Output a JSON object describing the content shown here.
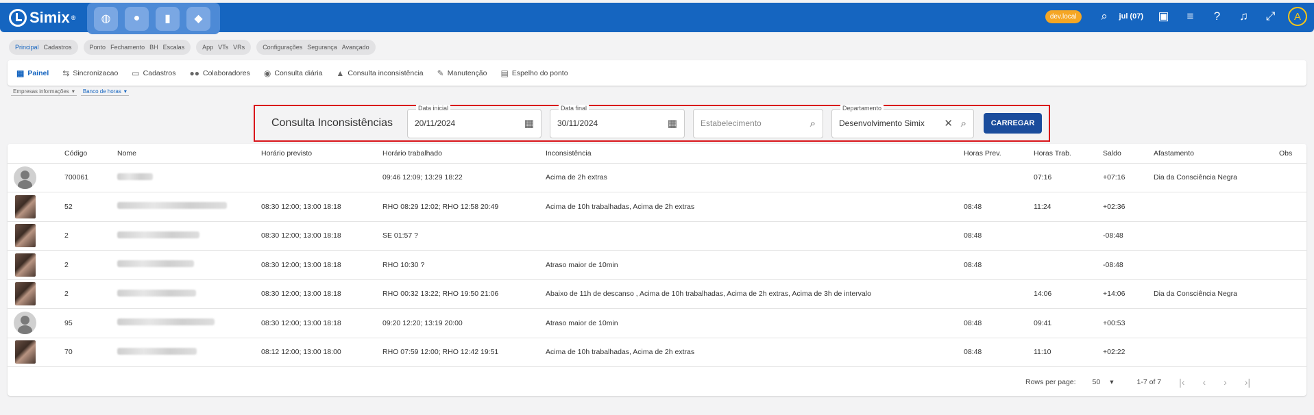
{
  "app": {
    "name": "Simix",
    "trademark": "®"
  },
  "topbar": {
    "env_badge": "dev.local",
    "month": "jul (07)",
    "avatar_letter": "A"
  },
  "groups": [
    {
      "items": [
        "Principal",
        "Cadastros"
      ]
    },
    {
      "items": [
        "Ponto",
        "Fechamento",
        "BH",
        "Escalas"
      ]
    },
    {
      "items": [
        "App",
        "VTs",
        "VRs"
      ]
    },
    {
      "items": [
        "Configurações",
        "Segurança",
        "Avançado"
      ]
    }
  ],
  "subnav": [
    {
      "label": "Painel",
      "icon": "dashboard-icon"
    },
    {
      "label": "Sincronizacao",
      "icon": "sync-icon"
    },
    {
      "label": "Cadastros",
      "icon": "folder-icon"
    },
    {
      "label": "Colaboradores",
      "icon": "people-icon"
    },
    {
      "label": "Consulta diária",
      "icon": "eye-icon"
    },
    {
      "label": "Consulta inconsistência",
      "icon": "warning-icon"
    },
    {
      "label": "Manutenção",
      "icon": "pencil-icon"
    },
    {
      "label": "Espelho do ponto",
      "icon": "printer-icon"
    }
  ],
  "chips": [
    "Empresas informações",
    "Banco de horas"
  ],
  "filter": {
    "title": "Consulta Inconsistências",
    "data_inicial_label": "Data inicial",
    "data_inicial": "20/11/2024",
    "data_final_label": "Data final",
    "data_final": "30/11/2024",
    "estabelecimento_placeholder": "Estabelecimento",
    "departamento_label": "Departamento",
    "departamento": "Desenvolvimento Simix",
    "button": "CARREGAR"
  },
  "table": {
    "headers": [
      "Código",
      "Nome",
      "Horário previsto",
      "Horário trabalhado",
      "Inconsistência",
      "Horas Prev.",
      "Horas Trab.",
      "Saldo",
      "Afastamento",
      "Obs"
    ],
    "rows": [
      {
        "avatar": "default",
        "codigo": "700061",
        "previsto": "",
        "trabalhado": "09:46 12:09; 13:29 18:22",
        "inconsistencia": "Acima de 2h extras",
        "horas_prev": "",
        "horas_trab": "07:16",
        "saldo": "+07:16",
        "afastamento": "Dia da Consciência Negra",
        "obs": ""
      },
      {
        "avatar": "photo",
        "codigo": "52",
        "previsto": "08:30 12:00; 13:00 18:18",
        "trabalhado": "RHO 08:29 12:02; RHO 12:58 20:49",
        "inconsistencia": "Acima de 10h trabalhadas, Acima de 2h extras",
        "horas_prev": "08:48",
        "horas_trab": "11:24",
        "saldo": "+02:36",
        "afastamento": "",
        "obs": ""
      },
      {
        "avatar": "photo",
        "codigo": "2",
        "previsto": "08:30 12:00; 13:00 18:18",
        "trabalhado": "SE 01:57 ?",
        "inconsistencia": "",
        "horas_prev": "08:48",
        "horas_trab": "",
        "saldo": "-08:48",
        "afastamento": "",
        "obs": ""
      },
      {
        "avatar": "photo",
        "codigo": "2",
        "previsto": "08:30 12:00; 13:00 18:18",
        "trabalhado": "RHO 10:30 ?",
        "inconsistencia": "Atraso maior de 10min",
        "horas_prev": "08:48",
        "horas_trab": "",
        "saldo": "-08:48",
        "afastamento": "",
        "obs": ""
      },
      {
        "avatar": "photo",
        "codigo": "2",
        "previsto": "08:30 12:00; 13:00 18:18",
        "trabalhado": "RHO 00:32 13:22; RHO 19:50 21:06",
        "inconsistencia": "Abaixo de 11h de descanso , Acima de 10h trabalhadas, Acima de 2h extras, Acima de 3h de intervalo",
        "horas_prev": "",
        "horas_trab": "14:06",
        "saldo": "+14:06",
        "afastamento": "Dia da Consciência Negra",
        "obs": ""
      },
      {
        "avatar": "default",
        "codigo": "95",
        "previsto": "08:30 12:00; 13:00 18:18",
        "trabalhado": "09:20 12:20; 13:19 20:00",
        "inconsistencia": "Atraso maior de 10min",
        "horas_prev": "08:48",
        "horas_trab": "09:41",
        "saldo": "+00:53",
        "afastamento": "",
        "obs": ""
      },
      {
        "avatar": "photo",
        "codigo": "70",
        "previsto": "08:12 12:00; 13:00 18:00",
        "trabalhado": "RHO 07:59 12:00; RHO 12:42 19:51",
        "inconsistencia": "Acima de 10h trabalhadas, Acima de 2h extras",
        "horas_prev": "08:48",
        "horas_trab": "11:10",
        "saldo": "+02:22",
        "afastamento": "",
        "obs": ""
      }
    ]
  },
  "pager": {
    "rows_per_page_label": "Rows per page:",
    "rows_per_page": "50",
    "range": "1-7 of 7"
  }
}
